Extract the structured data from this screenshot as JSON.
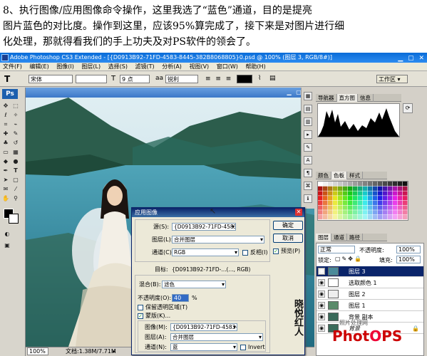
{
  "intro": {
    "line1": "8、执行图像/应用图像命令操作，这里我选了“蓝色”通道，目的是提亮",
    "line2": "图片蓝色的对比度。操作到这里，应该95%算完成了，接下来是对图片进行细",
    "line3": "化处理，那就得看我们的手上功夫及对PS软件的领会了。"
  },
  "window": {
    "title": "Adobe Photoshop CS3 Extended - [{D0913B92-71FD-4583-8445-382B8068805}0.psd @ 100% (图层 3, RGB/8#)]"
  },
  "menu": [
    "文件(F)",
    "编辑(E)",
    "图像(I)",
    "图层(L)",
    "选择(S)",
    "滤镜(T)",
    "分析(A)",
    "视图(V)",
    "窗口(W)",
    "帮助(H)"
  ],
  "options": {
    "font": "宋体",
    "size": "9 点",
    "aa": "锐利",
    "workspace": "工作区 ▾"
  },
  "status": {
    "zoom": "100%",
    "doc": "文档:1.38M/7.71M"
  },
  "dialog": {
    "title": "应用图像",
    "source_label": "源(S):",
    "source_value": "{D0913B92-71FD-4583-...",
    "layer_label": "图层(L):",
    "layer_value": "合并图层",
    "channel_label": "通道(C):",
    "channel_value": "RGB",
    "invert1": "反相(I)",
    "target_label": "目标:",
    "target_value": "{D0913B92-71FD-...(..., RGB)",
    "blend_label": "混合(B):",
    "blend_value": "滤色",
    "opacity_label": "不透明度(O):",
    "opacity_value": "40",
    "opacity_unit": "%",
    "preserve": "保留透明区域(T)",
    "mask": "蒙版(K)...",
    "img_label": "图像(M):",
    "img_value": "{D0913B92-71FD-4583-...",
    "mlayer_label": "图层(A):",
    "mlayer_value": "合并图层",
    "mchannel_label": "通道(N):",
    "mchannel_value": "蓝",
    "invert2": "Invert",
    "ok": "确定",
    "cancel": "取消",
    "preview": "预览(P)"
  },
  "panels": {
    "top_tabs": [
      "导航器",
      "直方图",
      "信息"
    ],
    "color_tabs": [
      "颜色",
      "色板",
      "样式"
    ],
    "layer_tabs": [
      "图层",
      "通道",
      "路径"
    ],
    "blend_mode": "正常",
    "opacity_label": "不透明度:",
    "opacity_value": "100%",
    "lock_label": "锁定:",
    "fill_label": "填充:",
    "fill_value": "100%",
    "layers": [
      "图层 3",
      "选取颜色 1",
      "图层 2",
      "图层 1",
      "背景 副本",
      "背景"
    ]
  },
  "logo": {
    "text_a": "Phot",
    "text_o": "O",
    "text_b": "PS",
    "sub": "照片处理网"
  },
  "signature": "晓悦红人"
}
